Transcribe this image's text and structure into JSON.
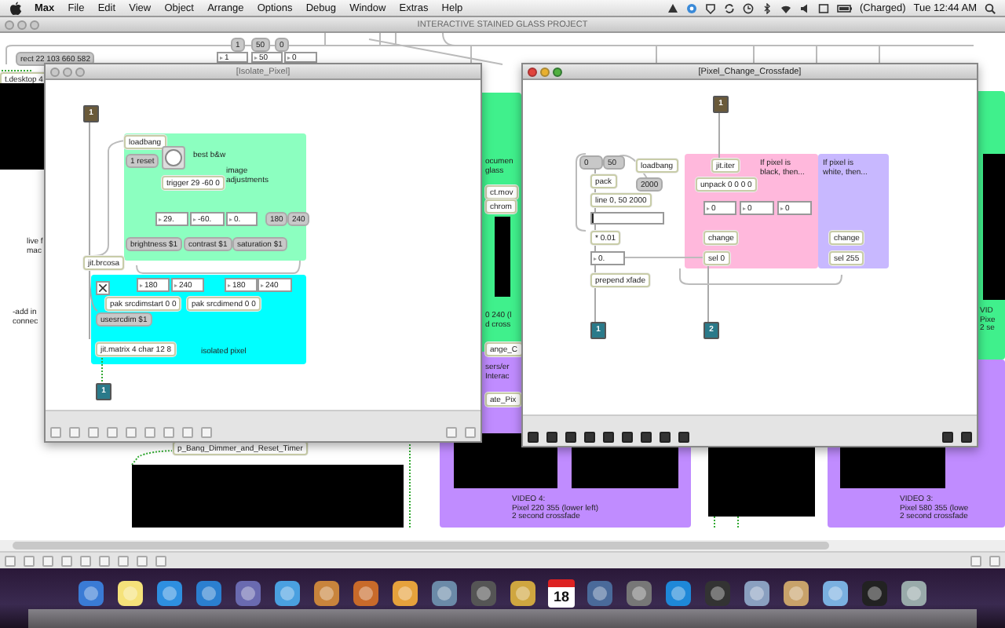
{
  "menu_bar": {
    "items": [
      {
        "label": "Max",
        "selected": true
      },
      {
        "label": "File",
        "selected": false
      },
      {
        "label": "Edit",
        "selected": false
      },
      {
        "label": "View",
        "selected": false
      },
      {
        "label": "Object",
        "selected": false
      },
      {
        "label": "Arrange",
        "selected": false
      },
      {
        "label": "Options",
        "selected": false
      },
      {
        "label": "Debug",
        "selected": false
      },
      {
        "label": "Window",
        "selected": false
      },
      {
        "label": "Extras",
        "selected": false
      },
      {
        "label": "Help",
        "selected": false
      }
    ],
    "battery": "(Charged)",
    "clock": "Tue 12:44 AM"
  },
  "main_window": {
    "title": "INTERACTIVE STAINED GLASS PROJECT",
    "active": false,
    "panels": [
      {
        "color": "#40f08c"
      },
      {
        "color": "#c08cff"
      },
      {
        "color": "#40f08c"
      },
      {
        "color": "#c08cff"
      },
      {
        "color": "#c08cff"
      },
      {
        "color": "#c08cff"
      }
    ],
    "objects": [
      {
        "kind": "message",
        "text": "1"
      },
      {
        "kind": "message",
        "text": "50"
      },
      {
        "kind": "message",
        "text": "0"
      },
      {
        "kind": "message",
        "text": "rect 22 103 660 582"
      },
      {
        "kind": "number",
        "text": "1"
      },
      {
        "kind": "number",
        "text": "50"
      },
      {
        "kind": "number",
        "text": "0"
      },
      {
        "kind": "object",
        "text": "t.desktop 4"
      },
      {
        "kind": "display"
      },
      {
        "kind": "comment",
        "text": "live f\nmac"
      },
      {
        "kind": "comment",
        "text": "-add in\nconnec"
      },
      {
        "kind": "comment",
        "text": "ocumen\nglass"
      },
      {
        "kind": "object",
        "text": "ct.mov"
      },
      {
        "kind": "object",
        "text": "chrom"
      },
      {
        "kind": "display"
      },
      {
        "kind": "comment",
        "text": "0 240 (l\nd cross"
      },
      {
        "kind": "object",
        "text": "ange_C"
      },
      {
        "kind": "comment",
        "text": "sers/er\nInterac"
      },
      {
        "kind": "object",
        "text": "ate_Pix"
      },
      {
        "kind": "display"
      },
      {
        "kind": "comment",
        "text": "VID\nPixe\n2 se"
      },
      {
        "kind": "object",
        "text": "p_Bang_Dimmer_and_Reset_Timer"
      },
      {
        "kind": "display"
      },
      {
        "kind": "display"
      },
      {
        "kind": "display"
      },
      {
        "kind": "comment",
        "text": "VIDEO 4:\nPixel 220 355 (lower left)\n2 second crossfade"
      },
      {
        "kind": "display"
      },
      {
        "kind": "display"
      },
      {
        "kind": "comment",
        "text": "VIDEO 3:\nPixel 580 355 (lowe\n2 second crossfade"
      }
    ]
  },
  "windows": [
    {
      "title": "[Isolate_Pixel]",
      "active": false,
      "panels": [
        {
          "color": "#8cffc0"
        },
        {
          "color": "#00ffff"
        }
      ],
      "objects": [
        {
          "kind": "inlet",
          "text": "1"
        },
        {
          "kind": "object",
          "text": "loadbang"
        },
        {
          "kind": "message",
          "text": "1 reset"
        },
        {
          "kind": "button"
        },
        {
          "kind": "comment",
          "text": "best b&w"
        },
        {
          "kind": "comment",
          "text": "image\nadjustments"
        },
        {
          "kind": "object",
          "text": "trigger 29 -60 0"
        },
        {
          "kind": "number",
          "text": "29."
        },
        {
          "kind": "number",
          "text": "-60."
        },
        {
          "kind": "number",
          "text": "0."
        },
        {
          "kind": "message",
          "text": "180"
        },
        {
          "kind": "message",
          "text": "240"
        },
        {
          "kind": "message",
          "text": "brightness $1"
        },
        {
          "kind": "message",
          "text": "contrast $1"
        },
        {
          "kind": "message",
          "text": "saturation $1"
        },
        {
          "kind": "object",
          "text": "jit.brcosa"
        },
        {
          "kind": "toggle",
          "checked": true
        },
        {
          "kind": "number",
          "text": "180"
        },
        {
          "kind": "number",
          "text": "240"
        },
        {
          "kind": "number",
          "text": "180"
        },
        {
          "kind": "number",
          "text": "240"
        },
        {
          "kind": "object",
          "text": "pak srcdimstart 0 0"
        },
        {
          "kind": "object",
          "text": "pak srcdimend 0 0"
        },
        {
          "kind": "message",
          "text": "usesrcdim $1"
        },
        {
          "kind": "object",
          "text": "jit.matrix 4 char 12 8"
        },
        {
          "kind": "comment",
          "text": "isolated pixel"
        },
        {
          "kind": "outlet",
          "text": "1"
        }
      ]
    },
    {
      "title": "[Pixel_Change_Crossfade]",
      "active": true,
      "panels": [
        {
          "color": "#ffb8dc"
        },
        {
          "color": "#c8b8ff"
        }
      ],
      "objects": [
        {
          "kind": "inlet",
          "text": "1"
        },
        {
          "kind": "message",
          "text": "0"
        },
        {
          "kind": "message",
          "text": "50"
        },
        {
          "kind": "object",
          "text": "loadbang"
        },
        {
          "kind": "object",
          "text": "pack"
        },
        {
          "kind": "message",
          "text": "2000"
        },
        {
          "kind": "object",
          "text": "line 0, 50 2000"
        },
        {
          "kind": "slider",
          "level": 0.02
        },
        {
          "kind": "object",
          "text": "* 0.01"
        },
        {
          "kind": "number",
          "text": "0."
        },
        {
          "kind": "object",
          "text": "prepend xfade"
        },
        {
          "kind": "outlet",
          "text": "1"
        },
        {
          "kind": "object",
          "text": "jit.iter"
        },
        {
          "kind": "comment",
          "text": "If pixel is\nblack, then..."
        },
        {
          "kind": "object",
          "text": "unpack 0 0 0 0"
        },
        {
          "kind": "number",
          "text": "0"
        },
        {
          "kind": "number",
          "text": "0"
        },
        {
          "kind": "number",
          "text": "0"
        },
        {
          "kind": "object",
          "text": "change"
        },
        {
          "kind": "object",
          "text": "sel 0"
        },
        {
          "kind": "outlet",
          "text": "2"
        },
        {
          "kind": "comment",
          "text": "If pixel is\nwhite, then..."
        },
        {
          "kind": "object",
          "text": "change"
        },
        {
          "kind": "object",
          "text": "sel 255"
        }
      ]
    }
  ],
  "dock": {
    "calendar_day": "18"
  }
}
